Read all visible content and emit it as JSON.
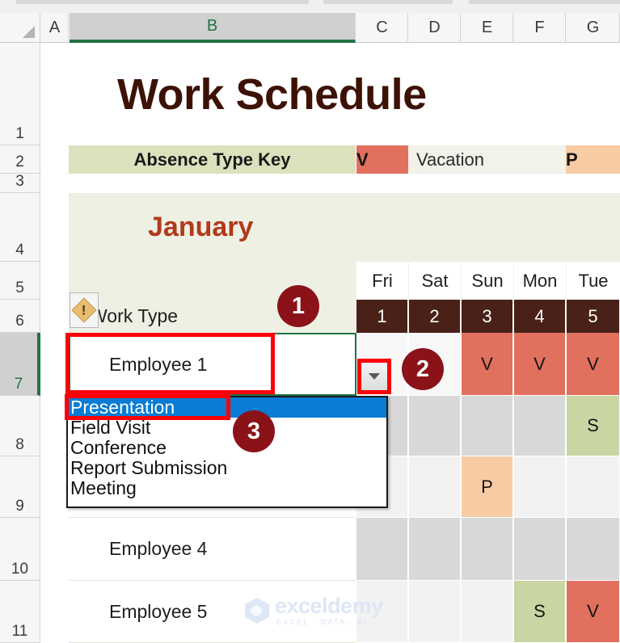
{
  "app": {
    "selected_column": "B",
    "selected_row": "7"
  },
  "columns": [
    {
      "id": "A",
      "label": "A"
    },
    {
      "id": "B",
      "label": "B"
    },
    {
      "id": "C",
      "label": "C"
    },
    {
      "id": "D",
      "label": "D"
    },
    {
      "id": "E",
      "label": "E"
    },
    {
      "id": "F",
      "label": "F"
    },
    {
      "id": "G",
      "label": "G"
    }
  ],
  "rows": [
    {
      "label": "1"
    },
    {
      "label": "2"
    },
    {
      "label": "3"
    },
    {
      "label": "4"
    },
    {
      "label": "5"
    },
    {
      "label": "6"
    },
    {
      "label": "7"
    },
    {
      "label": "8"
    },
    {
      "label": "9"
    },
    {
      "label": "10"
    },
    {
      "label": "11"
    }
  ],
  "sheet": {
    "title": "Work Schedule",
    "key_row": {
      "label": "Absence Type Key",
      "code_v": "V",
      "code_v_meaning": "Vacation",
      "code_p": "P"
    },
    "month": "January",
    "work_type_header": "Work Type",
    "day_names": [
      "Fri",
      "Sat",
      "Sun",
      "Mon",
      "Tue"
    ],
    "day_numbers": [
      "1",
      "2",
      "3",
      "4",
      "5"
    ],
    "employees": [
      {
        "name": "Employee 1",
        "marks": [
          "",
          "",
          "V",
          "V",
          "V"
        ]
      },
      {
        "name": "",
        "marks": [
          "",
          "",
          "",
          "",
          "S"
        ]
      },
      {
        "name": "",
        "marks": [
          "",
          "",
          "P",
          "",
          ""
        ]
      },
      {
        "name": "Employee 4",
        "marks": [
          "",
          "",
          "",
          "",
          ""
        ]
      },
      {
        "name": "Employee 5",
        "marks": [
          "",
          "",
          "",
          "S",
          "V"
        ]
      }
    ]
  },
  "dropdown": {
    "selected_value": "Presentation",
    "options": [
      "Presentation",
      "Field Visit",
      "Conference",
      "Report Submission",
      "Meeting"
    ]
  },
  "annotations": {
    "badges": [
      "1",
      "2",
      "3"
    ]
  },
  "warning": {
    "glyph": "!"
  },
  "watermark": {
    "name": "exceldemy",
    "tagline": "EXCEL - DATA - BI"
  },
  "colors": {
    "accent_green": "#217346",
    "title_brown": "#3d1205",
    "month_red": "#b03a1a",
    "vacation_red": "#e1705e",
    "sick_green": "#c9d6a3",
    "personal_peach": "#f7cba4",
    "date_header": "#4a2118",
    "key_band": "#dde0bd",
    "month_band": "#eff0e4",
    "annotation_red": "#fb0006",
    "badge_maroon": "#8b1219",
    "dropdown_highlight": "#0a7cd4"
  }
}
